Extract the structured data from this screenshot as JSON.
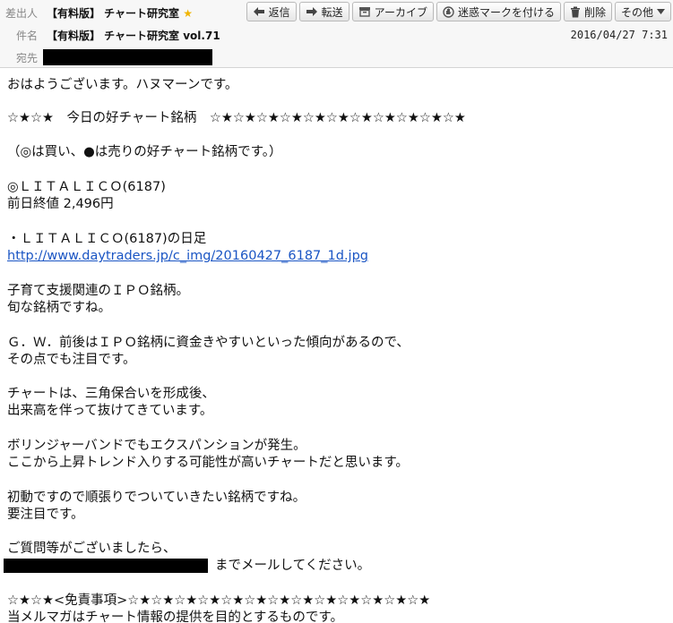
{
  "header": {
    "from_label": "差出人",
    "from_value": "【有料版】 チャート研究室",
    "subject_label": "件名",
    "subject_value": "【有料版】 チャート研究室 vol.71",
    "to_label": "宛先",
    "date": "2016/04/27 7:31"
  },
  "toolbar": {
    "reply": "返信",
    "forward": "転送",
    "archive": "アーカイブ",
    "spam": "迷惑マークを付ける",
    "delete": "削除",
    "more": "その他"
  },
  "icons": {
    "reply": "reply-arrow-icon",
    "forward": "forward-arrow-icon",
    "archive": "archive-box-icon",
    "spam": "spam-hand-icon",
    "delete": "trash-icon",
    "more": "chevron-down-icon",
    "star": "star-icon"
  },
  "colors": {
    "link": "#1a55c4",
    "star": "#f0b400",
    "redaction": "#000000"
  },
  "body": {
    "greeting": "おはようございます。ハヌマーンです。",
    "heading": "☆★☆★　今日の好チャート銘柄　☆★☆★☆★☆★☆★☆★☆★☆★☆★☆★☆★",
    "legend": "（◎は買い、●は売りの好チャート銘柄です。）",
    "stock_name": "◎ＬＩＴＡＬＩＣＯ(6187)",
    "prev_close": "前日終値 2,496円",
    "chart_title": "・ＬＩＴＡＬＩＣＯ(6187)の日足",
    "chart_link": "http://www.daytraders.jp/c_img/20160427_6187_1d.jpg",
    "p1_l1": "子育て支援関連のＩＰＯ銘柄。",
    "p1_l2": "旬な銘柄ですね。",
    "p2_l1": "Ｇ．Ｗ．前後はＩＰＯ銘柄に資金きやすいといった傾向があるので、",
    "p2_l2": "その点でも注目です。",
    "p3_l1": "チャートは、三角保合いを形成後、",
    "p3_l2": "出来高を伴って抜けてきています。",
    "p4_l1": "ボリンジャーバンドでもエクスパンションが発生。",
    "p4_l2": "ここから上昇トレンド入りする可能性が高いチャートだと思います。",
    "p5_l1": "初動ですので順張りでついていきたい銘柄ですね。",
    "p5_l2": "要注目です。",
    "contact_l1": "ご質問等がございましたら、",
    "contact_l2_suffix": "までメールしてください。",
    "disclaimer_heading": "☆★☆★<免責事項>☆★☆★☆★☆★☆★☆★☆★☆★☆★☆★☆★☆★☆★",
    "disclaimer_l1": "当メルマガはチャート情報の提供を目的とするものです。"
  }
}
